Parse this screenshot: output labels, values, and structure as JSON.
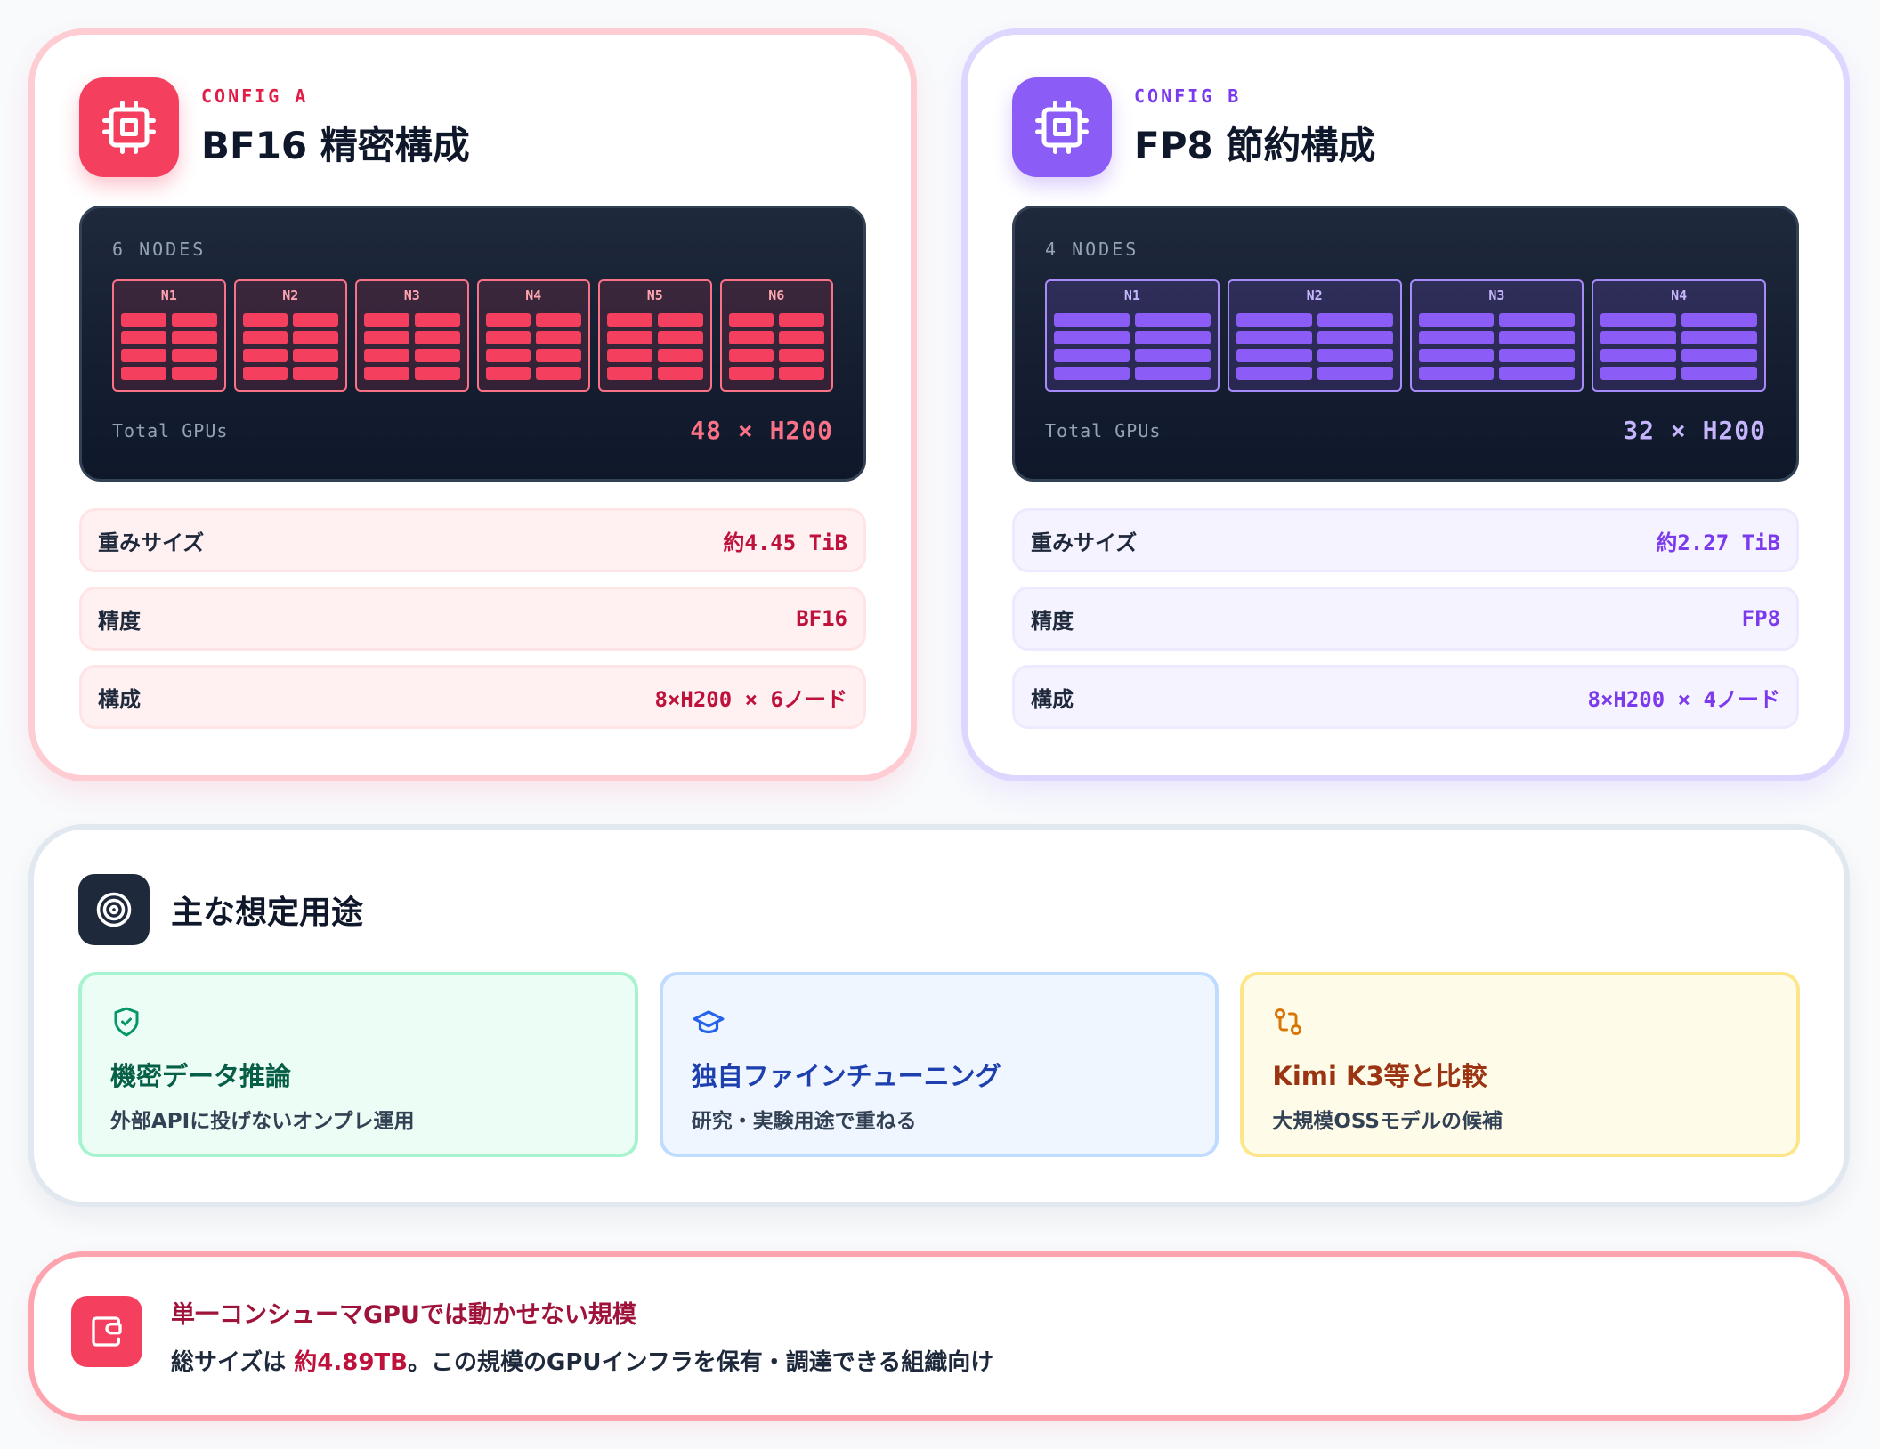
{
  "colors": {
    "config_a_accent": "#f43f5e",
    "config_b_accent": "#8b5cf6",
    "dark_panel": "#0f172a"
  },
  "config_a": {
    "label": "CONFIG A",
    "title": "BF16 精密構成",
    "icon": "chip-icon",
    "cluster": {
      "nodes_label": "6 NODES",
      "nodes": [
        "N1",
        "N2",
        "N3",
        "N4",
        "N5",
        "N6"
      ],
      "gpus_per_node": 8,
      "total_label": "Total GPUs",
      "total_value": "48 × H200"
    },
    "specs": [
      {
        "label": "重みサイズ",
        "value": "約4.45 TiB"
      },
      {
        "label": "精度",
        "value": "BF16"
      },
      {
        "label": "構成",
        "value": "8×H200 × 6ノード"
      }
    ]
  },
  "config_b": {
    "label": "CONFIG B",
    "title": "FP8 節約構成",
    "icon": "chip-icon",
    "cluster": {
      "nodes_label": "4 NODES",
      "nodes": [
        "N1",
        "N2",
        "N3",
        "N4"
      ],
      "gpus_per_node": 8,
      "total_label": "Total GPUs",
      "total_value": "32 × H200"
    },
    "specs": [
      {
        "label": "重みサイズ",
        "value": "約2.27 TiB"
      },
      {
        "label": "精度",
        "value": "FP8"
      },
      {
        "label": "構成",
        "value": "8×H200 × 4ノード"
      }
    ]
  },
  "use_cases": {
    "title": "主な想定用途",
    "icon": "target-icon",
    "cards": [
      {
        "icon": "shield-check-icon",
        "title": "機密データ推論",
        "desc": "外部APIに投げないオンプレ運用"
      },
      {
        "icon": "graduation-cap-icon",
        "title": "独自ファインチューニング",
        "desc": "研究・実験用途で重ねる"
      },
      {
        "icon": "git-compare-icon",
        "title": "Kimi K3等と比較",
        "desc": "大規模OSSモデルの候補"
      }
    ]
  },
  "note": {
    "icon": "wallet-icon",
    "title": "単一コンシューマGPUでは動かせない規模",
    "body_prefix": "総サイズは ",
    "body_highlight": "約4.89TB",
    "body_suffix": "。この規模のGPUインフラを保有・調達できる組織向け"
  }
}
